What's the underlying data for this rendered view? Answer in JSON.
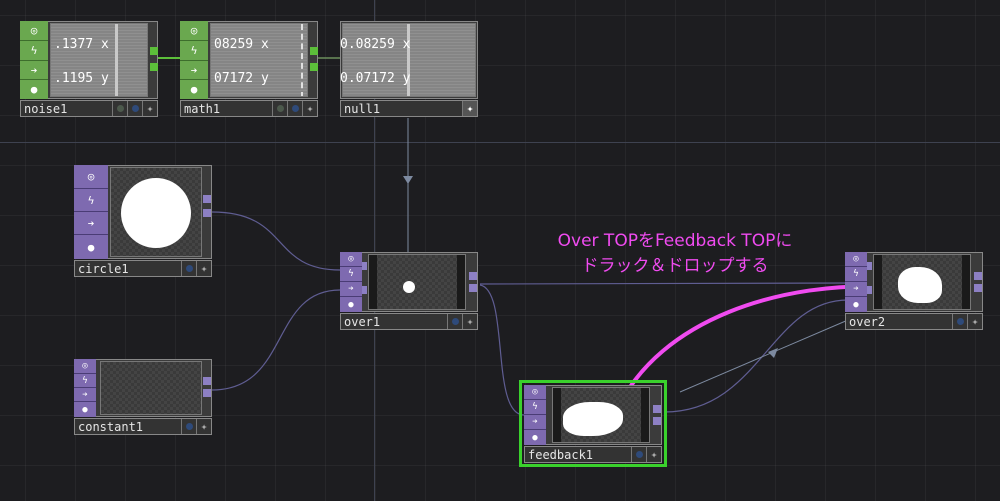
{
  "nodes": {
    "noise1": {
      "name": "noise1",
      "values": [
        ".1377",
        ".1195"
      ],
      "channels": [
        "x",
        "y"
      ]
    },
    "math1": {
      "name": "math1",
      "values": [
        "08259",
        "07172"
      ],
      "channels": [
        "x",
        "y"
      ]
    },
    "null1": {
      "name": "null1",
      "values": [
        "0.08259",
        "0.07172"
      ],
      "channels": [
        "x",
        "y"
      ]
    },
    "circle1": {
      "name": "circle1"
    },
    "constant1": {
      "name": "constant1"
    },
    "over1": {
      "name": "over1"
    },
    "over2": {
      "name": "over2"
    },
    "feedback1": {
      "name": "feedback1"
    }
  },
  "annotation": {
    "line1": "Over TOPをFeedback TOPに",
    "line2": "ドラック＆ドロップする"
  },
  "colors": {
    "chop_family": "#6aa84f",
    "top_family": "#7e6ab0",
    "selection": "#3ad12c",
    "annotation": "#f04bf0"
  },
  "icons": {
    "flag_viewer": "viewer-icon",
    "flag_cook": "lightning-icon",
    "flag_bypass": "arrow-icon",
    "flag_lock": "lock-icon",
    "flag_display": "display-icon",
    "flag_star": "star-icon"
  }
}
